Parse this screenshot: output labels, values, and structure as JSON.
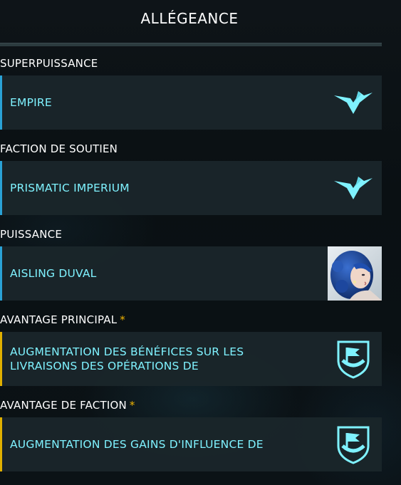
{
  "header": {
    "title": "ALLÉGEANCE"
  },
  "sections": [
    {
      "label": "SUPERPUISSANCE",
      "value": "EMPIRE",
      "icon": "empire-emblem-icon"
    },
    {
      "label": "FACTION DE SOUTIEN",
      "value": "PRISMATIC IMPERIUM",
      "icon": "empire-emblem-icon"
    },
    {
      "label": "PUISSANCE",
      "value": "AISLING DUVAL",
      "icon": "aisling-duval-portrait"
    },
    {
      "label": "AVANTAGE PRINCIPAL",
      "marker": "*",
      "value": "AUGMENTATION DES BÉNÉFICES SUR LES LIVRAISONS DES OPÉRATIONS DE",
      "icon": "flag-shield-icon"
    },
    {
      "label": "AVANTAGE DE FACTION",
      "marker": "*",
      "value": "AUGMENTATION DES GAINS D'INFLUENCE DE",
      "icon": "flag-shield-icon"
    }
  ],
  "colors": {
    "accent_blue": "#2aa2d6",
    "accent_gold": "#e0b000",
    "text_cyan": "#7ff2ff",
    "star": "#f0b400"
  }
}
